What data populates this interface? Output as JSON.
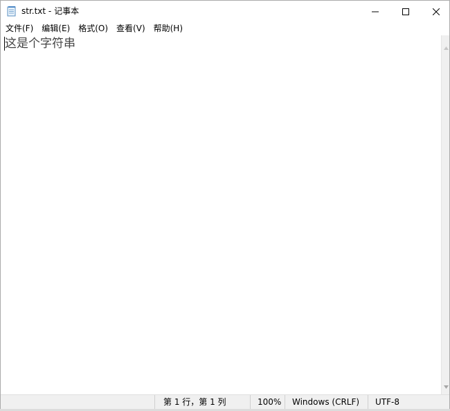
{
  "window": {
    "title": "str.txt - 记事本",
    "app_icon": "notepad-icon",
    "controls": {
      "minimize_icon": "minimize-icon",
      "maximize_icon": "maximize-icon",
      "close_icon": "close-icon"
    }
  },
  "menu": {
    "items": [
      {
        "label": "文件(F)"
      },
      {
        "label": "编辑(E)"
      },
      {
        "label": "格式(O)"
      },
      {
        "label": "查看(V)"
      },
      {
        "label": "帮助(H)"
      }
    ]
  },
  "editor": {
    "content": "这是个字符串"
  },
  "statusbar": {
    "position": "第 1 行，第 1 列",
    "zoom": "100%",
    "line_ending": "Windows (CRLF)",
    "encoding": "UTF-8"
  }
}
